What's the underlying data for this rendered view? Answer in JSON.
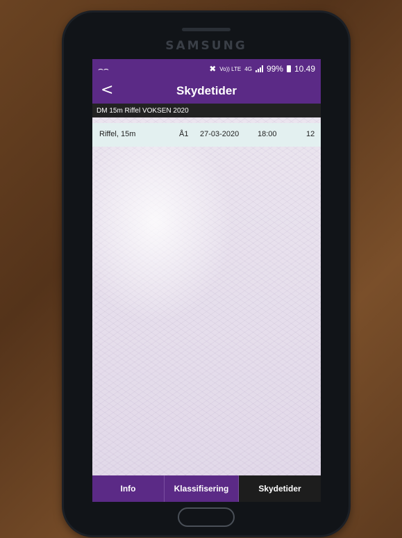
{
  "device": {
    "brand": "SAMSUNG"
  },
  "statusbar": {
    "left_icon": "voicemail-icon",
    "mute_icon": "mute-icon",
    "volte": "Vo)) LTE",
    "network": "4G",
    "battery": "99%",
    "time": "10.49"
  },
  "appbar": {
    "back_icon": "<",
    "title": "Skydetider"
  },
  "subheader": {
    "text": "DM 15m Riffel VOKSEN 2020"
  },
  "rows": [
    {
      "discipline": "Riffel, 15m",
      "class": "Å1",
      "date": "27-03-2020",
      "time": "18:00",
      "number": "12"
    }
  ],
  "tabs": [
    {
      "label": "Info"
    },
    {
      "label": "Klassifisering"
    },
    {
      "label": "Skydetider"
    }
  ],
  "colors": {
    "primary": "#5b2a86",
    "active_tab": "#1d1d1d",
    "row_bg": "#e3f0f0"
  }
}
